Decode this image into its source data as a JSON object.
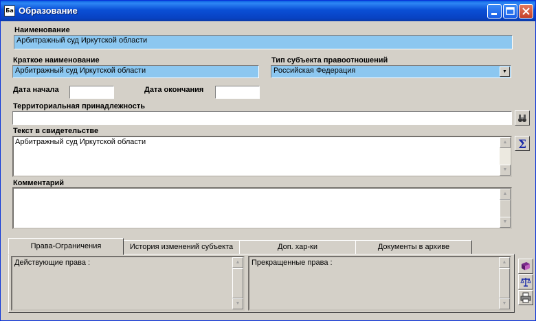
{
  "window": {
    "title": "Образование",
    "icon_text": "Ба"
  },
  "form": {
    "name_label": "Наименование",
    "name_value": "Арбитражный суд Иркутской области",
    "short_name_label": "Краткое наименование",
    "short_name_value": "Арбитражный суд Иркутской области",
    "subject_type_label": "Тип субъекта правоотношений",
    "subject_type_value": "Российская Федерация",
    "start_date_label": "Дата начала",
    "start_date_value": "",
    "end_date_label": "Дата окончания",
    "end_date_value": "",
    "territory_label": "Территориальная принадлежность",
    "territory_value": "",
    "certificate_text_label": "Текст в свидетельстве",
    "certificate_text_value": "Арбитражный суд Иркутской области",
    "comment_label": "Комментарий",
    "comment_value": ""
  },
  "tabs": [
    {
      "label": "Права-Ограничения",
      "active": true
    },
    {
      "label": "История изменений субъекта",
      "active": false
    },
    {
      "label": "Доп. хар-ки",
      "active": false
    },
    {
      "label": "Документы в архиве",
      "active": false
    }
  ],
  "tab_panel": {
    "current_rights_label": "Действующие права :",
    "terminated_rights_label": "Прекращенные права :"
  },
  "icons": {
    "territory_lookup": "binoculars-icon",
    "certificate_sum": "sigma-icon",
    "side_buttons": [
      "book-icon",
      "scales-icon",
      "printer-icon"
    ]
  },
  "colors": {
    "field_highlight": "#8cc7f0",
    "title_bar": "#0a4fd6",
    "window_bg": "#d4d0c8"
  }
}
